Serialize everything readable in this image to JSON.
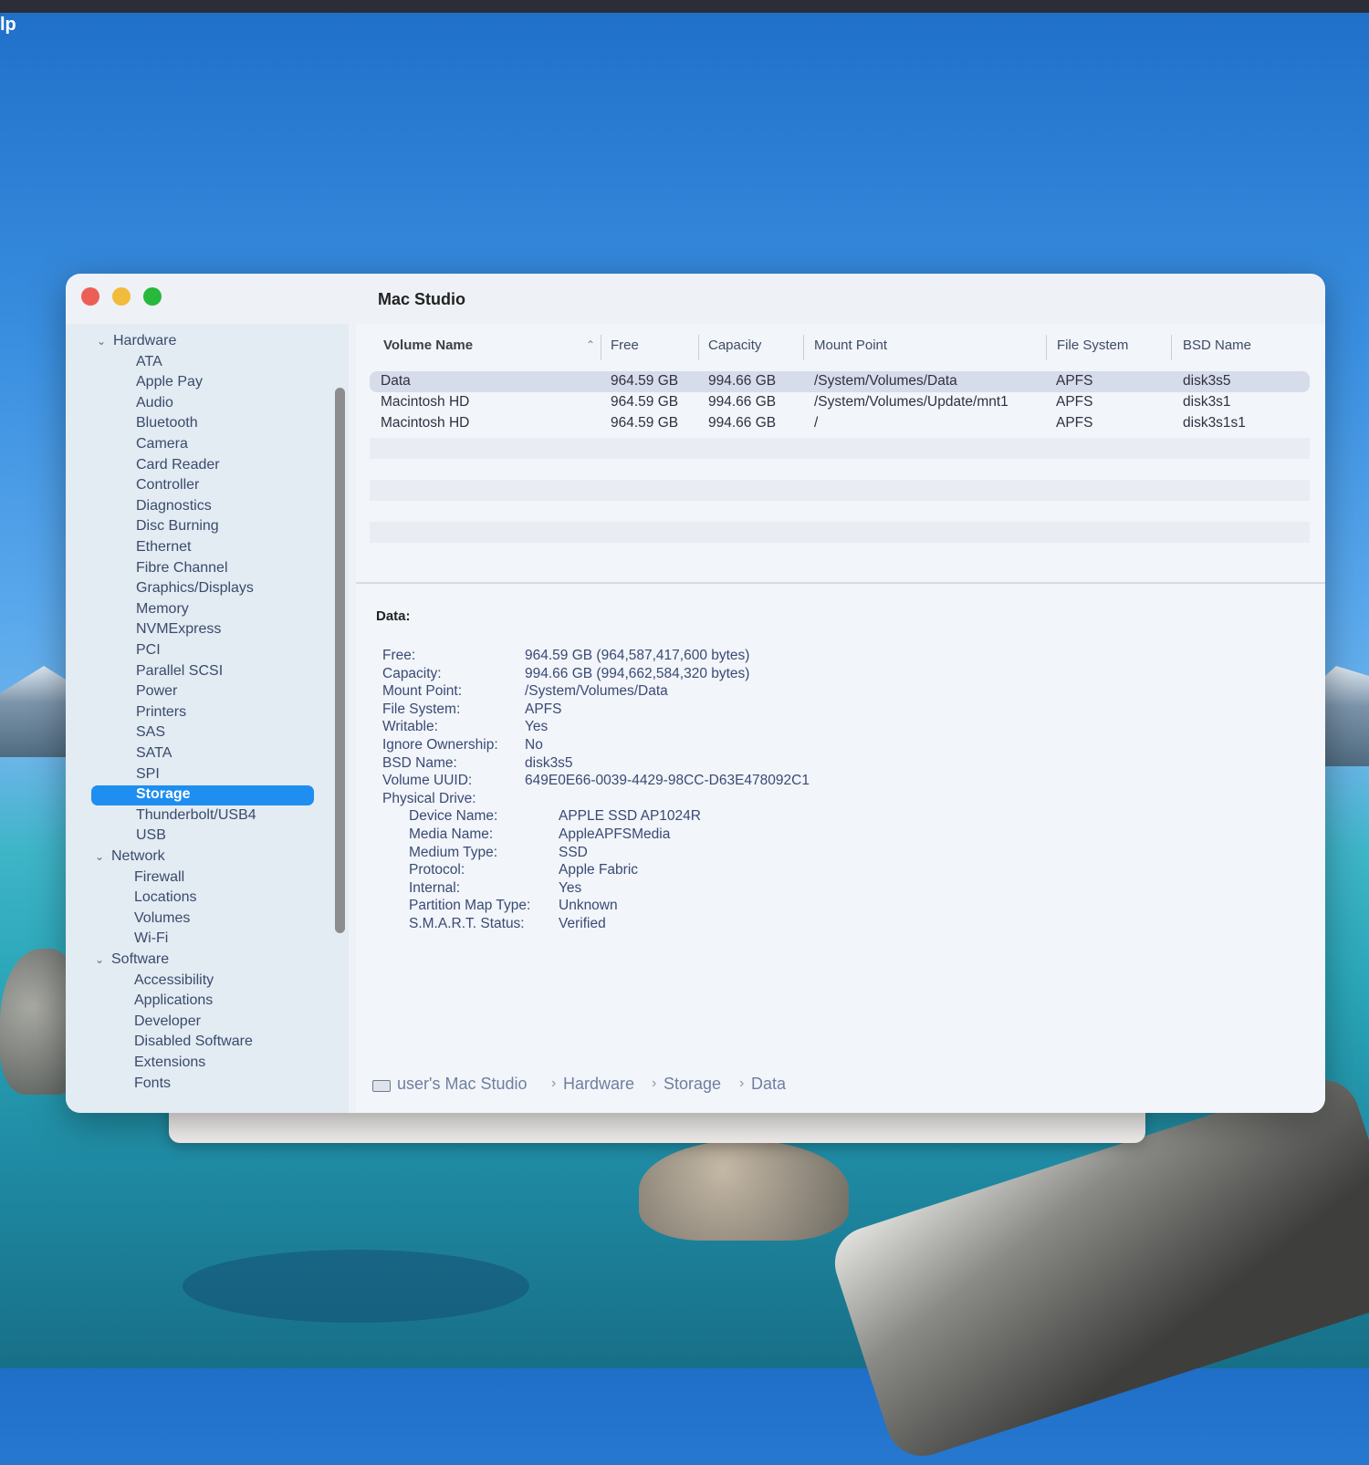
{
  "menubar": {
    "fragment": "lp"
  },
  "window": {
    "title": "Mac Studio",
    "traffic": {
      "close": "close",
      "minimize": "minimize",
      "zoom": "zoom"
    }
  },
  "sidebar": {
    "groups": [
      {
        "label": "Hardware",
        "items": [
          "ATA",
          "Apple Pay",
          "Audio",
          "Bluetooth",
          "Camera",
          "Card Reader",
          "Controller",
          "Diagnostics",
          "Disc Burning",
          "Ethernet",
          "Fibre Channel",
          "Graphics/Displays",
          "Memory",
          "NVMExpress",
          "PCI",
          "Parallel SCSI",
          "Power",
          "Printers",
          "SAS",
          "SATA",
          "SPI",
          "Storage",
          "Thunderbolt/USB4",
          "USB"
        ]
      },
      {
        "label": "Network",
        "items": [
          "Firewall",
          "Locations",
          "Volumes",
          "Wi-Fi"
        ]
      },
      {
        "label": "Software",
        "items": [
          "Accessibility",
          "Applications",
          "Developer",
          "Disabled Software",
          "Extensions",
          "Fonts"
        ]
      }
    ],
    "selected": "Storage"
  },
  "table": {
    "headers": {
      "volume_name": "Volume Name",
      "free": "Free",
      "capacity": "Capacity",
      "mount_point": "Mount Point",
      "file_system": "File System",
      "bsd_name": "BSD Name"
    },
    "sort_icon": "chevron-up-icon",
    "rows": [
      {
        "volume_name": "Data",
        "free": "964.59 GB",
        "capacity": "994.66 GB",
        "mount_point": "/System/Volumes/Data",
        "file_system": "APFS",
        "bsd_name": "disk3s5"
      },
      {
        "volume_name": "Macintosh HD",
        "free": "964.59 GB",
        "capacity": "994.66 GB",
        "mount_point": "/System/Volumes/Update/mnt1",
        "file_system": "APFS",
        "bsd_name": "disk3s1"
      },
      {
        "volume_name": "Macintosh HD",
        "free": "964.59 GB",
        "capacity": "994.66 GB",
        "mount_point": "/",
        "file_system": "APFS",
        "bsd_name": "disk3s1s1"
      }
    ]
  },
  "details": {
    "title": "Data:",
    "fields": [
      {
        "label": "Free:",
        "value": "964.59 GB (964,587,417,600 bytes)"
      },
      {
        "label": "Capacity:",
        "value": "994.66 GB (994,662,584,320 bytes)"
      },
      {
        "label": "Mount Point:",
        "value": "/System/Volumes/Data"
      },
      {
        "label": "File System:",
        "value": "APFS"
      },
      {
        "label": "Writable:",
        "value": "Yes"
      },
      {
        "label": "Ignore Ownership:",
        "value": "No"
      },
      {
        "label": "BSD Name:",
        "value": "disk3s5"
      },
      {
        "label": "Volume UUID:",
        "value": "649E0E66-0039-4429-98CC-D63E478092C1"
      },
      {
        "label": "Physical Drive:",
        "value": ""
      }
    ],
    "physical_drive": [
      {
        "label": "Device Name:",
        "value": "APPLE SSD AP1024R"
      },
      {
        "label": "Media Name:",
        "value": "AppleAPFSMedia"
      },
      {
        "label": "Medium Type:",
        "value": "SSD"
      },
      {
        "label": "Protocol:",
        "value": "Apple Fabric"
      },
      {
        "label": "Internal:",
        "value": "Yes"
      },
      {
        "label": "Partition Map Type:",
        "value": "Unknown"
      },
      {
        "label": "S.M.A.R.T. Status:",
        "value": "Verified"
      }
    ]
  },
  "pathbar": {
    "icon": "computer-icon",
    "segments": [
      "user's Mac Studio",
      "Hardware",
      "Storage",
      "Data"
    ],
    "separator": "›"
  }
}
